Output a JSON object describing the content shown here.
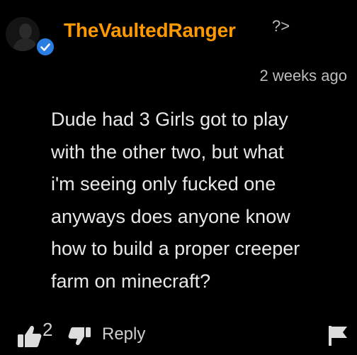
{
  "comment": {
    "username": "TheVaultedRanger",
    "user_symbol": "?>",
    "timestamp": "2 weeks ago",
    "lines": [
      "Dude had 3 Girls got to play",
      "with the other two, but what",
      "i'm seeing only fucked one",
      "anyways does anyone know",
      "how to build a proper creeper",
      "farm on minecraft?"
    ],
    "like_count": "2",
    "reply_label": "Reply"
  },
  "icons": {
    "avatar": "user-avatar-silhouette",
    "verified": "checkmark-badge-icon",
    "like": "thumbs-up-icon",
    "dislike": "thumbs-down-icon",
    "flag": "flag-icon"
  },
  "colors": {
    "background": "#000000",
    "username": "#ff9900",
    "text": "#e8e8e8",
    "muted": "#bdbdbd",
    "verified": "#2a7de1"
  }
}
